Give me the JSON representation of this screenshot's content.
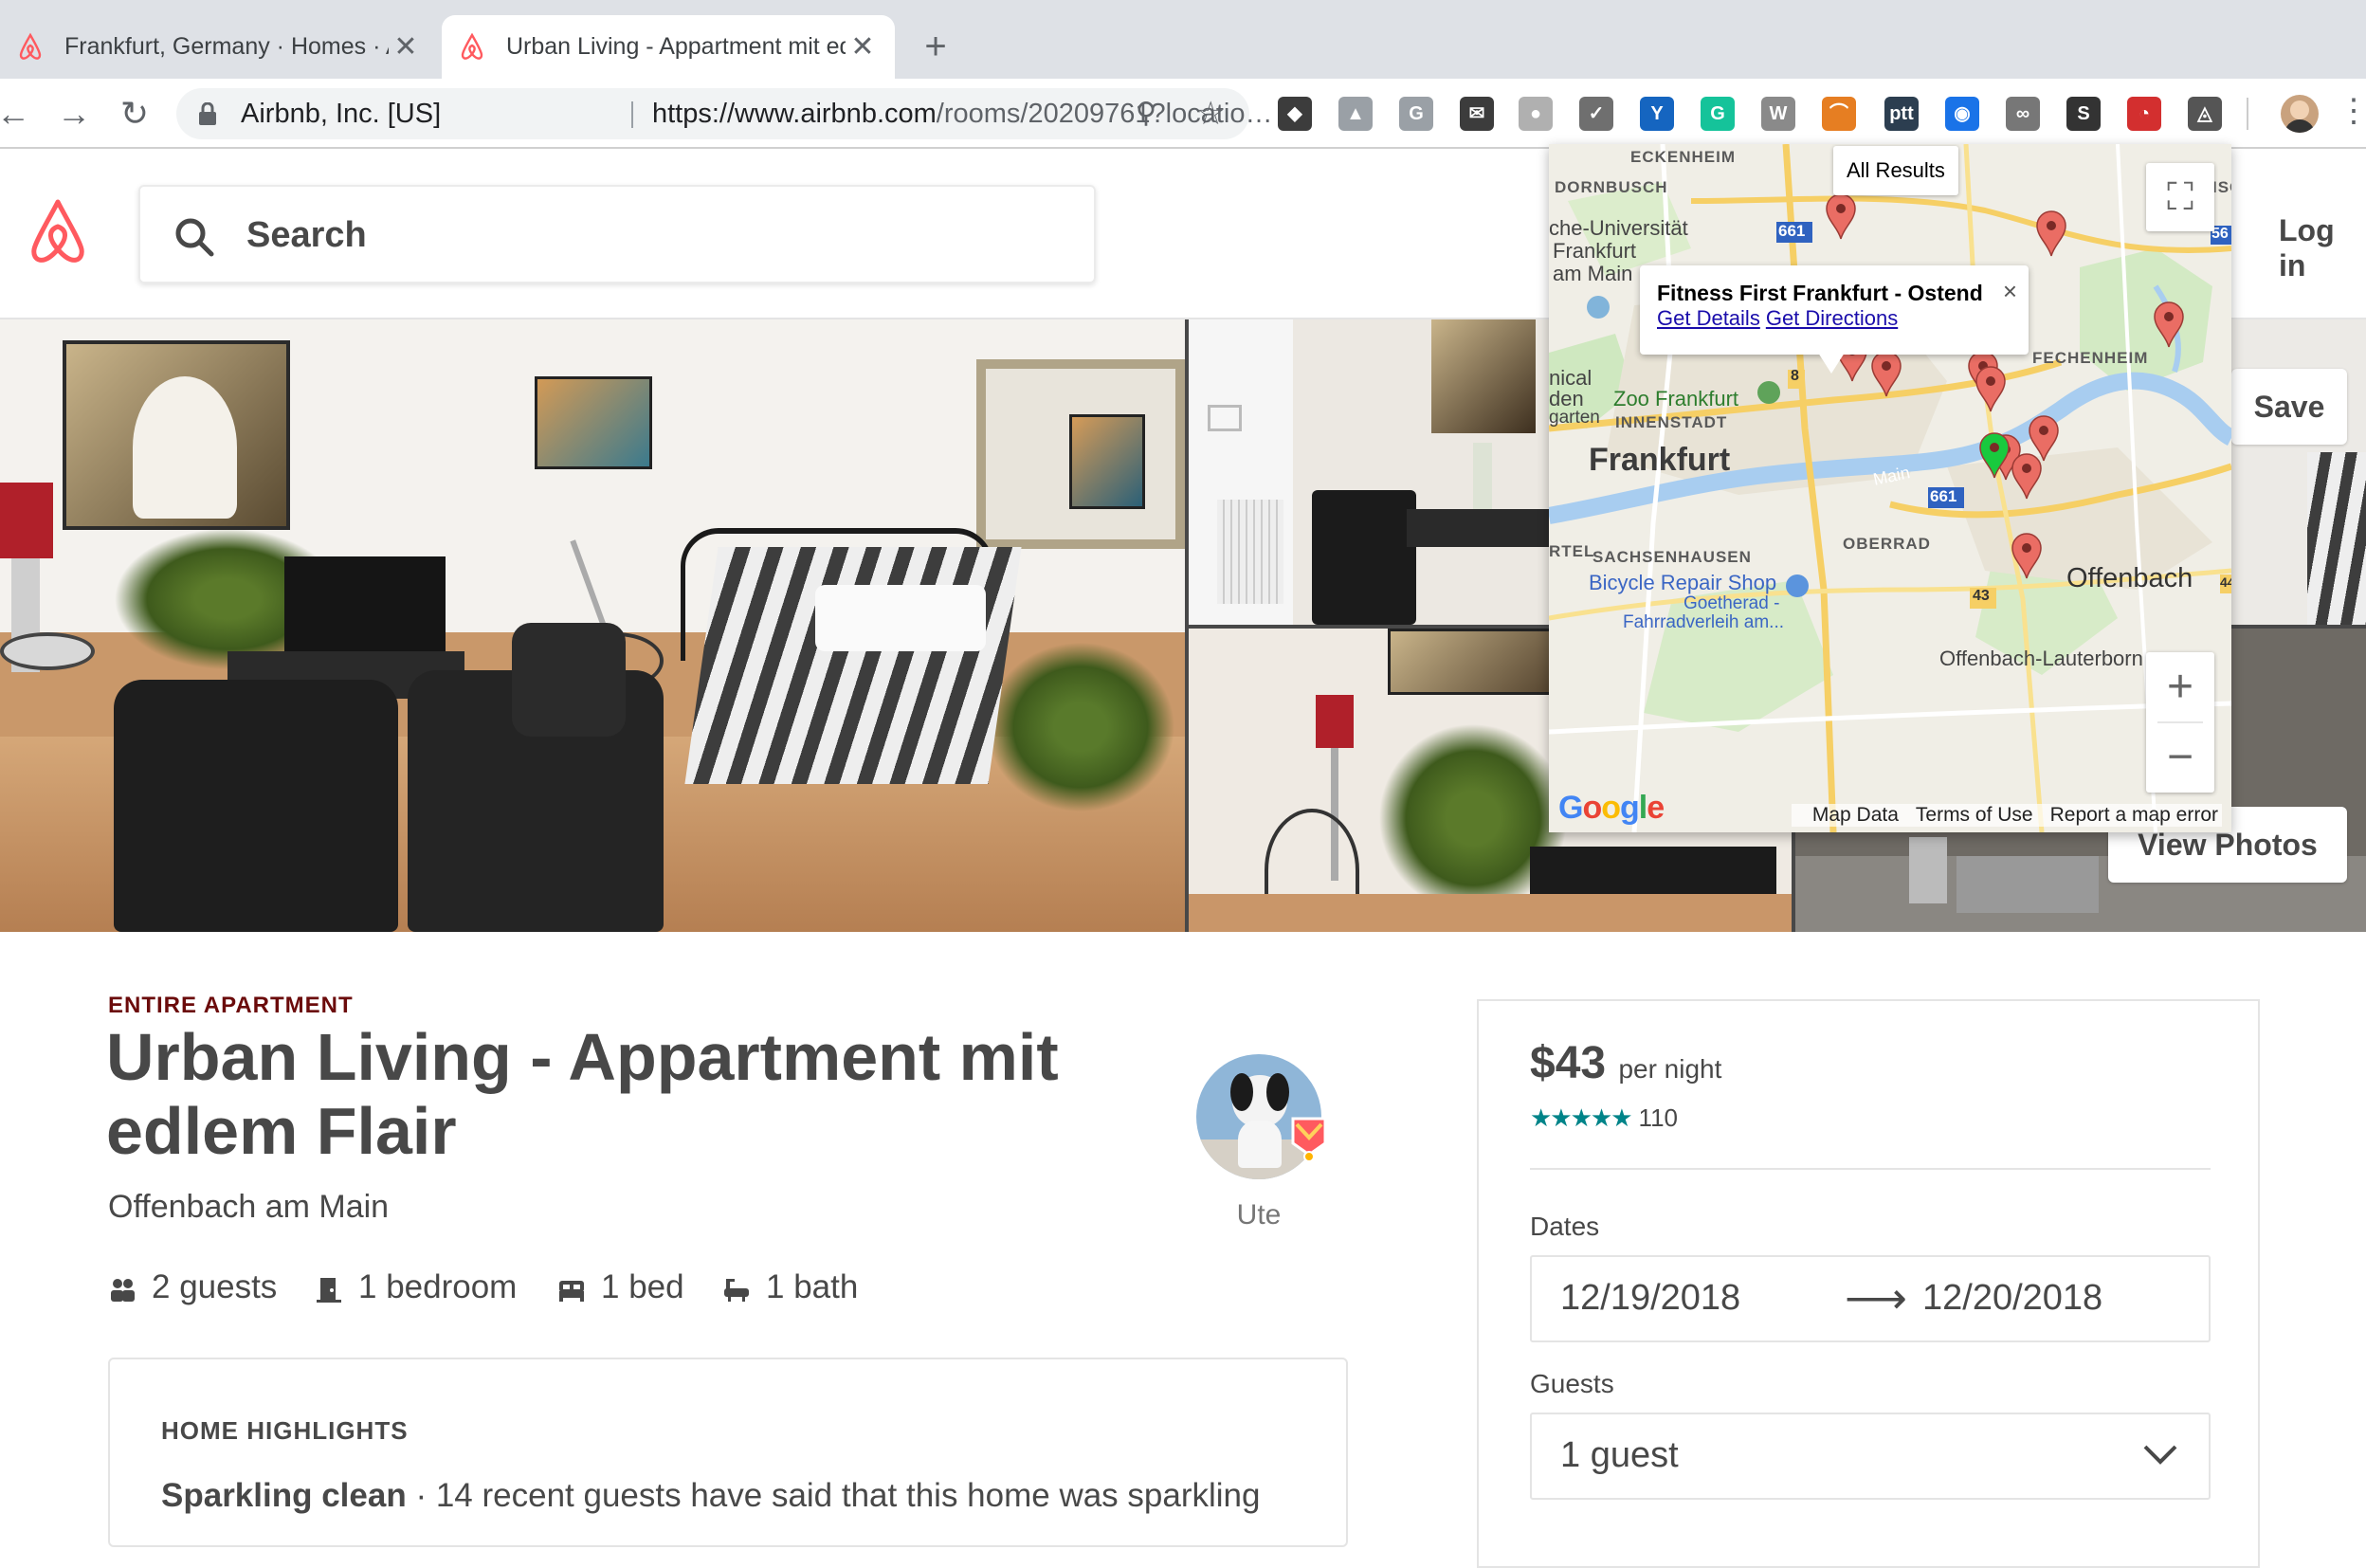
{
  "browser": {
    "tabs": [
      {
        "title": "Frankfurt, Germany · Homes · Airbnb",
        "active": false
      },
      {
        "title": "Urban Living - Appartment mit edlem Flair",
        "active": true
      }
    ],
    "close_glyph": "✕",
    "new_tab_glyph": "+",
    "nav": {
      "back": "←",
      "forward": "→",
      "reload": "↻"
    },
    "address": {
      "org": "Airbnb, Inc. [US]",
      "url_host": "https://www.airbnb.com",
      "url_path": "/rooms/20209761?locatio…"
    },
    "zoom_glyph": "⚲",
    "star_glyph": "☆",
    "extensions": [
      {
        "name": "pocket-icon",
        "glyph": "◆",
        "color": "#3c3c3c"
      },
      {
        "name": "drive-icon",
        "glyph": "▲",
        "color": "#9aa0a6"
      },
      {
        "name": "g-ext-icon",
        "glyph": "G",
        "color": "#9aa0a6"
      },
      {
        "name": "mail-ext-icon",
        "glyph": "✉",
        "color": "#3c3c3c"
      },
      {
        "name": "circle-ext-icon",
        "glyph": "●",
        "color": "#b0b0b0"
      },
      {
        "name": "check-ext-icon",
        "glyph": "✓",
        "color": "#6f6f6f"
      },
      {
        "name": "y-ext-icon",
        "glyph": "Y",
        "color": "#1565c0"
      },
      {
        "name": "grammarly-icon",
        "glyph": "G",
        "color": "#15c39a"
      },
      {
        "name": "wikipedia-icon",
        "glyph": "W",
        "color": "#8a8a8a"
      },
      {
        "name": "rainbow-ext-icon",
        "glyph": "⌒",
        "color": "#e67e22"
      },
      {
        "name": "ptt-ext-icon",
        "glyph": "ptt",
        "color": "#2c3e50"
      },
      {
        "name": "lock-ext-icon",
        "glyph": "◉",
        "color": "#1a73e8"
      },
      {
        "name": "bike-ext-icon",
        "glyph": "∞",
        "color": "#777"
      },
      {
        "name": "s-ext-icon",
        "glyph": "S",
        "color": "#333"
      },
      {
        "name": "red-ext-icon",
        "glyph": "◔",
        "color": "#d32f2f"
      },
      {
        "name": "airbnb-ext-icon",
        "glyph": "◬",
        "color": "#555"
      }
    ],
    "menu_glyph": "⋮"
  },
  "header": {
    "search_placeholder": "Search",
    "login_label": "Log in"
  },
  "photos": {
    "save_label": "Save",
    "view_photos_label": "View Photos"
  },
  "map": {
    "all_results_label": "All Results",
    "fullscreen_glyph": "⛶",
    "zoom_in": "+",
    "zoom_out": "−",
    "info": {
      "title": "Fitness First Frankfurt - Ostend",
      "close": "×",
      "details_link": "Get Details",
      "directions_link": "Get Directions"
    },
    "labels": {
      "eckenheim": "ECKENHEIM",
      "dornbusch": "DORNBUSCH",
      "uni": "che-Universität",
      "frankfurt_small": "Frankfurt",
      "am_main": "am Main",
      "nical": "nical",
      "den": "den",
      "garten": "garten",
      "zoo": "Zoo Frankfurt",
      "innenstadt": "INNENSTADT",
      "frankfurt": "Frankfurt",
      "main_river": "Main",
      "road_661_a": "661",
      "road_661_b": "661",
      "road_8": "8",
      "road_43": "43",
      "road_44": "44",
      "road_56": "56",
      "fechenheim": "FECHENHEIM",
      "isc": "ISC",
      "rtel": "RTEL",
      "sachsenhausen": "SACHSENHAUSEN",
      "oberrad": "OBERRAD",
      "bicycle_shop": "Bicycle Repair Shop",
      "goetherad": "Goetherad -",
      "fahrrad": "Fahrradverleih am...",
      "offenbach": "Offenbach",
      "offenbach_lauterborn": "Offenbach-Lauterborn"
    },
    "google_logo": "Google",
    "footer_links": [
      "Map Data",
      "Terms of Use",
      "Report a map error"
    ]
  },
  "listing": {
    "kind": "ENTIRE APARTMENT",
    "title": "Urban Living - Appartment mit edlem Flair",
    "city": "Offenbach am Main",
    "host_name": "Ute",
    "amenities": [
      {
        "icon": "guests-icon",
        "label": "2 guests"
      },
      {
        "icon": "bedroom-icon",
        "label": "1 bedroom"
      },
      {
        "icon": "bed-icon",
        "label": "1 bed"
      },
      {
        "icon": "bath-icon",
        "label": "1 bath"
      }
    ],
    "highlights": {
      "heading": "HOME HIGHLIGHTS",
      "first_bold": "Sparkling clean",
      "first_text": " · 14 recent guests have said that this home was sparkling"
    }
  },
  "booking": {
    "price": "$43",
    "per_night": "per night",
    "stars": "★★★★★",
    "review_count": "110",
    "dates_label": "Dates",
    "check_in": "12/19/2018",
    "check_out": "12/20/2018",
    "arrow_glyph": "⟶",
    "guests_label": "Guests",
    "guests_value": "1 guest",
    "chevron_glyph": "⌄"
  },
  "colors": {
    "brand": "#ff5a5f",
    "teal": "#008489",
    "map_pin": "#ea6d64",
    "selected_pin": "#19c93e"
  }
}
